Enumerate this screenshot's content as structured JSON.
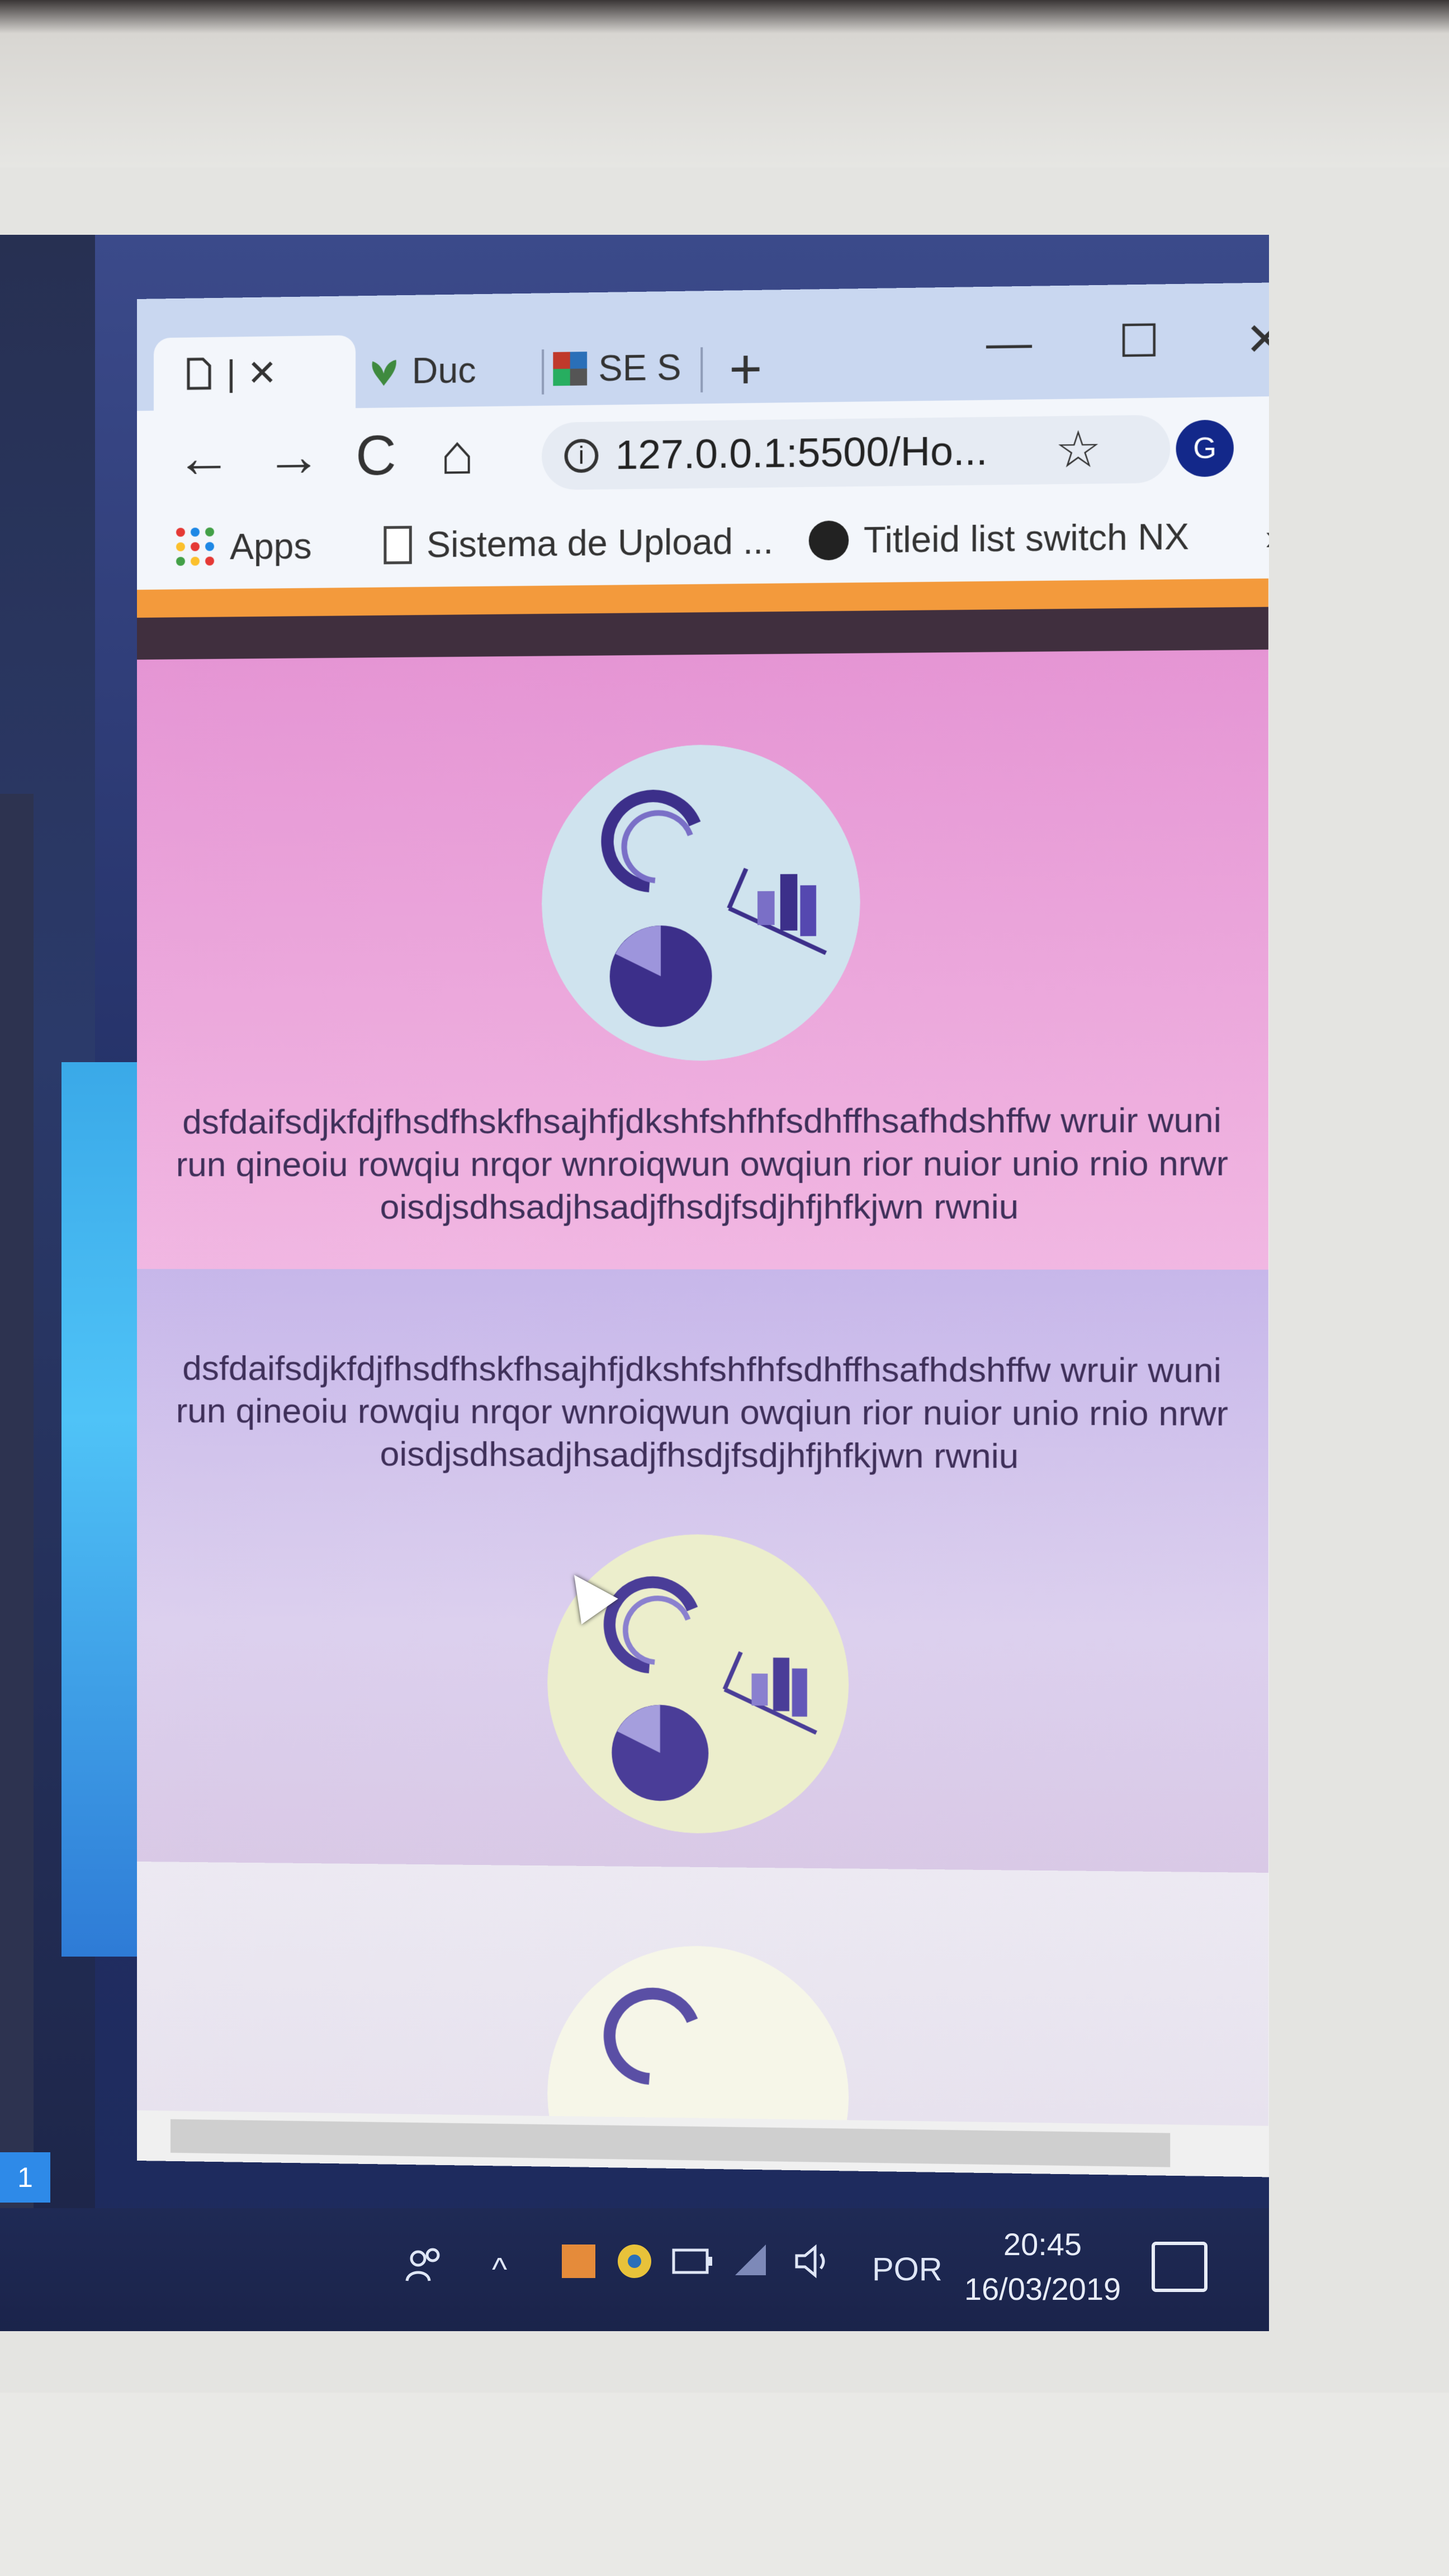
{
  "browser": {
    "tabs": [
      {
        "label": "|",
        "active": true,
        "icon": "page-icon"
      },
      {
        "label": "Duc",
        "icon": "plant-icon"
      },
      {
        "label": "SE S",
        "icon": "flag-icon"
      }
    ],
    "new_tab_label": "+",
    "window_controls": {
      "minimize": "—",
      "maximize": "☐",
      "close": "✕"
    },
    "tab_close": "✕",
    "nav": {
      "back": "←",
      "forward": "→",
      "reload": "C",
      "home": "⌂"
    },
    "address": "127.0.0.1:5500/Ho...",
    "star": "☆",
    "avatar_letter": "G",
    "menu": "⋮",
    "bookmarks": [
      {
        "label": "Apps",
        "icon": "apps-grid-icon"
      },
      {
        "label": "Sistema de Upload ...",
        "icon": "page-icon"
      },
      {
        "label": "Titleid list switch NX",
        "icon": "github-icon"
      }
    ],
    "bookmarks_more": "»"
  },
  "page": {
    "sections": [
      {
        "text": "dsfdaifsdjkfdjfhsdfhskfhsajhfjdkshfshfhfsdhffhsafhdshffw wruir wuni run qineoiu rowqiu nrqor wnroiqwun owqiun rior nuior unio rnio nrwr oisdjsdhsadjhsadjfhsdjfsdjhfjhfkjwn rwniu"
      },
      {
        "text": "dsfdaifsdjkfdjfhsdfhskfhsajhfjdkshfshfhfsdhffhsafhdshffw wruir wuni run qineoiu rowqiu nrqor wnroiqwun owqiun rior nuior unio rnio nrwr oisdjsdhsadjhsadjfhsdjfsdjhfjhfkjwn rwniu"
      }
    ]
  },
  "taskbar": {
    "language": "POR",
    "time": "20:45",
    "date": "16/03/2019",
    "badge": "1"
  },
  "colors": {
    "orange_strip": "#f39a3c",
    "dark_strip": "#402f3e",
    "section1": "#e595d4",
    "section2": "#c7b7ea",
    "illustration_bg": "#cfe3ee",
    "illustration_dark": "#3c2f8a"
  }
}
